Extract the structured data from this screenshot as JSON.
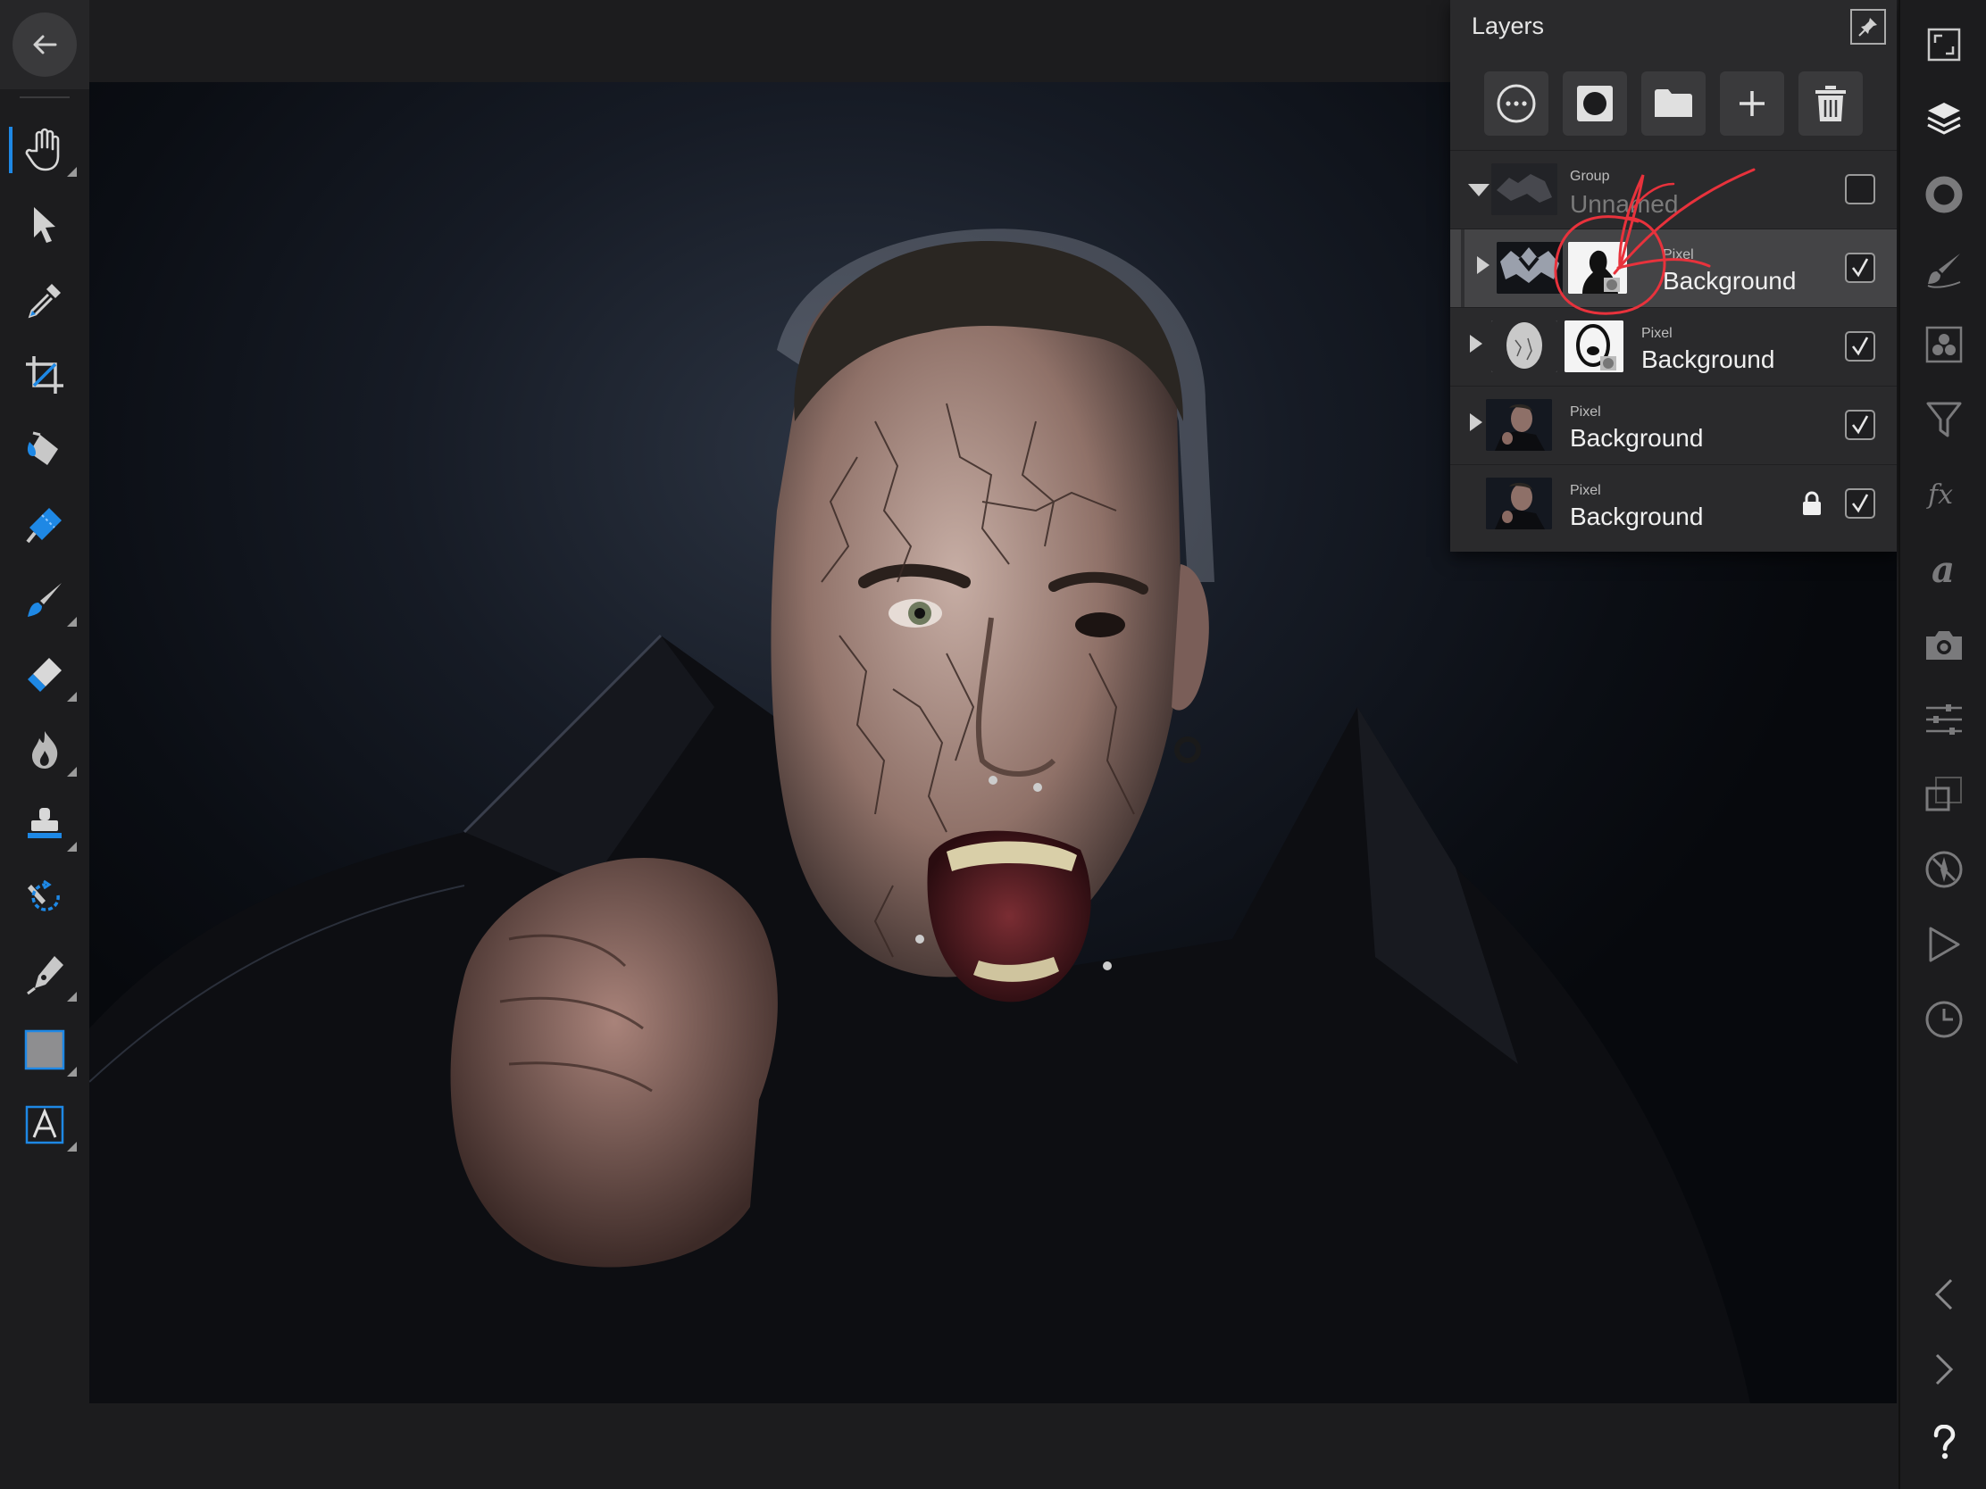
{
  "top_toolbar": {
    "buttons": [
      {
        "name": "back-icon"
      },
      {
        "name": "document-icon"
      },
      {
        "name": "more-icon"
      }
    ],
    "personas": [
      {
        "name": "photo-persona-icon",
        "accent": "#b64ce8"
      },
      {
        "name": "liquify-persona-icon"
      },
      {
        "name": "develop-persona-icon"
      },
      {
        "name": "tone-mapping-persona-icon"
      },
      {
        "name": "export-persona-icon"
      }
    ]
  },
  "tools": [
    "hand-tool-icon",
    "move-tool-icon",
    "color-picker-icon",
    "crop-tool-icon",
    "flood-fill-icon",
    "selection-brush-icon",
    "paint-brush-icon",
    "erase-brush-icon",
    "dodge-burn-icon",
    "clone-stamp-icon",
    "inpainting-icon",
    "pen-tool-icon",
    "rectangle-tool-icon",
    "text-tool-icon"
  ],
  "layers_panel": {
    "title": "Layers",
    "rows": [
      {
        "type": "Group",
        "name": "Unnamed",
        "visible": false,
        "expanded": true,
        "locked": false
      },
      {
        "type": "Pixel",
        "name": "Background",
        "visible": true,
        "selected": true,
        "locked": false
      },
      {
        "type": "Pixel",
        "name": "Background",
        "visible": true,
        "locked": false
      },
      {
        "type": "Pixel",
        "name": "Background",
        "visible": true,
        "locked": false
      },
      {
        "type": "Pixel",
        "name": "Background",
        "visible": true,
        "locked": true
      }
    ],
    "annotation_color": "#e8323c"
  },
  "studio": [
    "fullscreen-icon",
    "layers-icon",
    "color-icon",
    "brushes-icon",
    "channels-icon",
    "adjustments-icon",
    "fx-icon",
    "text-styles-icon",
    "snapshots-icon",
    "sliders-icon",
    "transform-icon",
    "navigator-icon",
    "macro-icon",
    "history-icon",
    "chevron-left-icon",
    "chevron-right-icon",
    "help-icon"
  ],
  "colors": {
    "accent_blue": "#1e88e5",
    "annotation_red": "#e8323c",
    "panel_bg": "#2a2a2c"
  }
}
